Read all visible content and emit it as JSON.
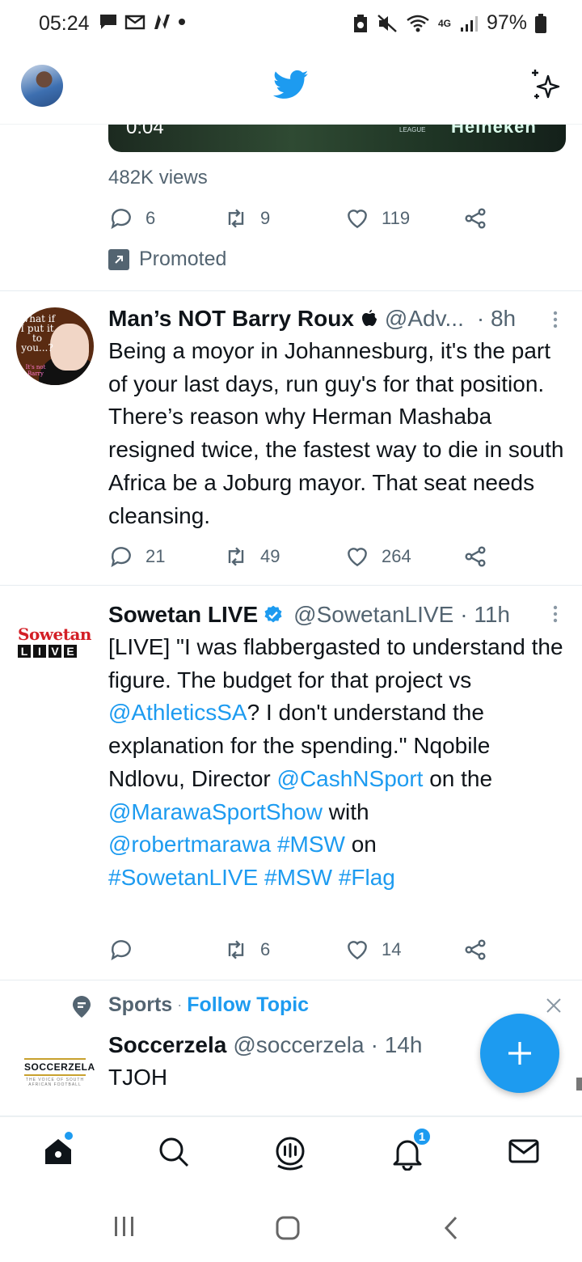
{
  "status_bar": {
    "time": "05:24",
    "battery": "97%",
    "network": "4G"
  },
  "header": {
    "logo_icon": "twitter-bird-icon",
    "sparkle_icon": "sparkle-icon"
  },
  "promo_tweet": {
    "video_time": "0:04",
    "video_brand": "Heineken",
    "video_league": "LEAGUE",
    "views": "482K views",
    "replies": "6",
    "retweets": "9",
    "likes": "119",
    "promoted_label": "Promoted"
  },
  "tweet1": {
    "name": "Man’s NOT Barry Roux",
    "handle": "@Adv...",
    "time": "· 8h",
    "avatar_text": "What if I put it to you...?",
    "avatar_sub": "It's not Barry",
    "body": "Being a moyor in Johannesburg, it's the part of your last days, run guy's for that position. There’s reason why Herman Mashaba resigned twice, the fastest way to die in south Africa be a Joburg mayor. That seat needs cleansing.",
    "replies": "21",
    "retweets": "49",
    "likes": "264"
  },
  "tweet2": {
    "name": "Sowetan LIVE",
    "handle": "@SowetanLIVE",
    "time": "· 11h",
    "logo_top": "Sowetan",
    "logo_letters": [
      "L",
      "I",
      "V",
      "E"
    ],
    "body_1": "[LIVE] \"I was flabbergasted to understand the figure. The budget for that project vs ",
    "mention_1": "@AthleticsSA",
    "body_2": "? I don't understand the explanation for the spending.\"  Nqobile Ndlovu, Director ",
    "mention_2": "@CashNSport",
    "body_3": " on the ",
    "mention_3": "@MarawaSportShow",
    "body_4": " with ",
    "mention_4": "@robertmarawa",
    "hashtag_1": "#MSW",
    "body_5": " on ",
    "hashtag_2": "#SowetanLIVE",
    "hashtag_3": "#MSW",
    "hashtag_4": "#Flag",
    "retweets": "6",
    "likes": "14"
  },
  "topic": {
    "name": "Sports",
    "separator": "·",
    "follow": "Follow Topic",
    "account_name": "Soccerzela",
    "handle": "@soccerzela",
    "time": "· 14h",
    "body": "TJOH",
    "logo_text": "SOCCERZELA",
    "logo_sub": "THE VOICE OF SOUTH AFRICAN FOOTBALL"
  },
  "bottom_nav": {
    "notifications_badge": "1"
  },
  "colors": {
    "accent": "#1d9bf0",
    "secondary_text": "#536471"
  }
}
